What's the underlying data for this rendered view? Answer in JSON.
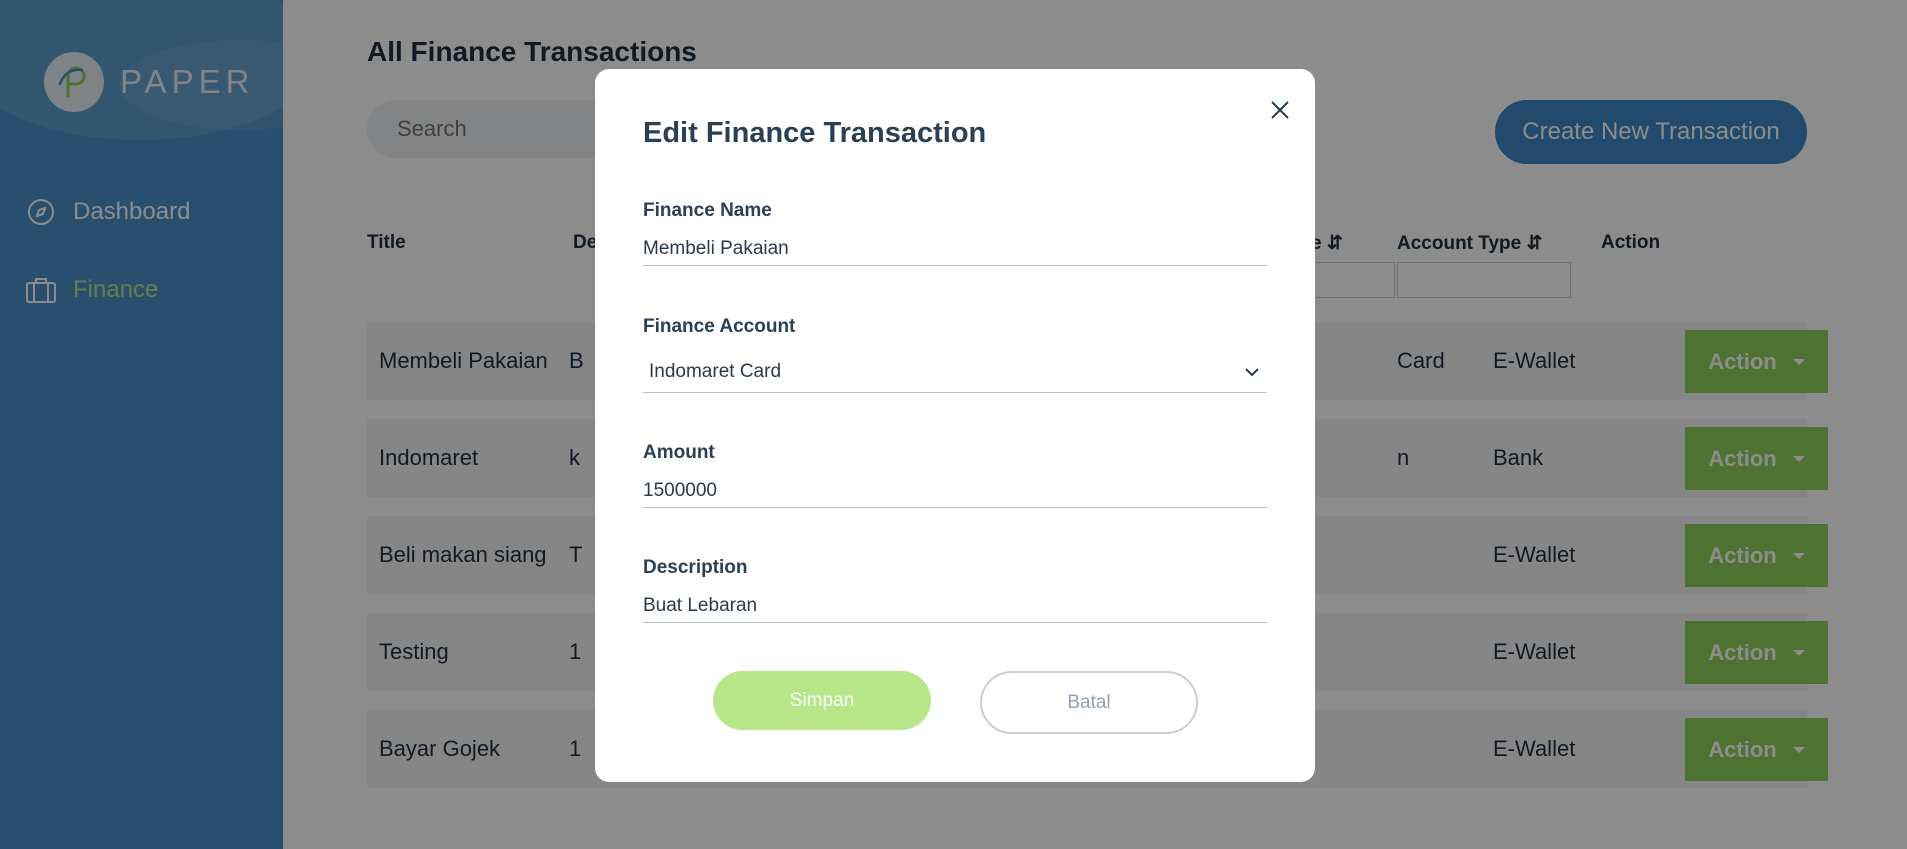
{
  "brand": {
    "name": "PAPER"
  },
  "sidebar": {
    "items": [
      {
        "label": "Dashboard",
        "icon": "compass-icon"
      },
      {
        "label": "Finance",
        "icon": "briefcase-icon"
      }
    ]
  },
  "page": {
    "title": "All Finance Transactions",
    "search_placeholder": "Search",
    "create_button": "Create New Transaction"
  },
  "table": {
    "headers": {
      "title": "Title",
      "description_partial": "De",
      "account_name_partial": "e ⇵",
      "account_type": "Account Type ⇵",
      "action": "Action"
    },
    "rows": [
      {
        "title": "Membeli Pakaian",
        "description_partial": "B",
        "account_partial": "Card",
        "account_type": "E-Wallet",
        "action": "Action"
      },
      {
        "title": "Indomaret",
        "description_partial": "k",
        "account_partial": "n",
        "account_type": "Bank",
        "action": "Action"
      },
      {
        "title": "Beli makan siang",
        "description_partial": "T",
        "account_partial": "",
        "account_type": "E-Wallet",
        "action": "Action"
      },
      {
        "title": "Testing",
        "description_partial": "1",
        "account_partial": "",
        "account_type": "E-Wallet",
        "action": "Action"
      },
      {
        "title": "Bayar Gojek",
        "description_partial": "1",
        "account_partial": "",
        "account_type": "E-Wallet",
        "action": "Action"
      }
    ]
  },
  "modal": {
    "title": "Edit Finance Transaction",
    "fields": {
      "name": {
        "label": "Finance Name",
        "value": "Membeli Pakaian"
      },
      "account": {
        "label": "Finance Account",
        "value": "Indomaret Card"
      },
      "amount": {
        "label": "Amount",
        "value": "1500000"
      },
      "description": {
        "label": "Description",
        "value": "Buat Lebaran"
      }
    },
    "save_label": "Simpan",
    "cancel_label": "Batal"
  },
  "colors": {
    "sidebar": "#4a90c8",
    "accent_green": "#8fd05a",
    "primary_blue": "#3f88c5"
  }
}
